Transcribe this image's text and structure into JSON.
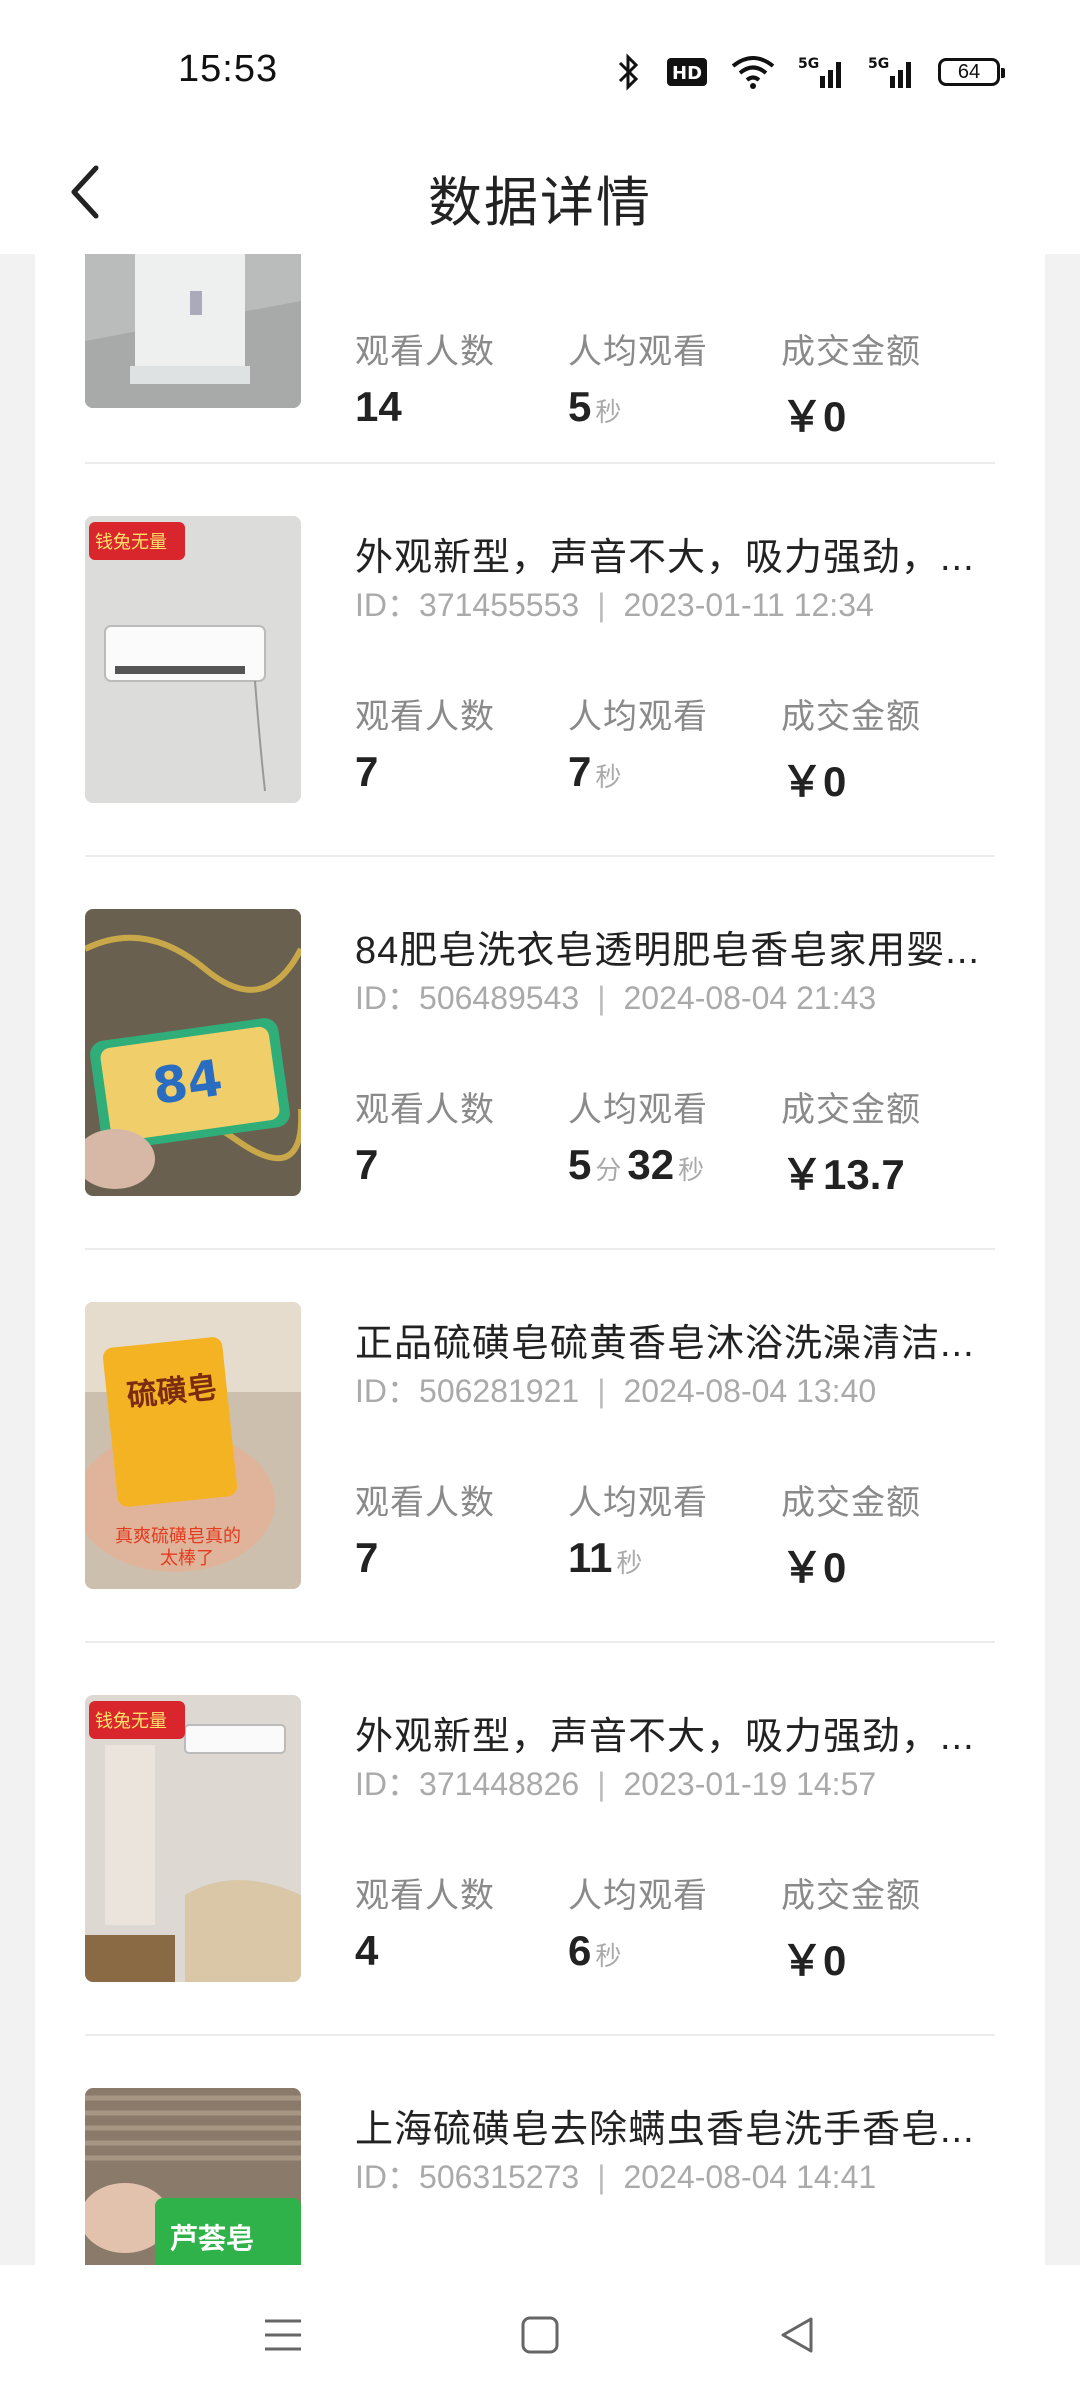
{
  "status_bar": {
    "time": "15:53",
    "icons": [
      "bluetooth-icon",
      "hd-icon",
      "wifi-icon",
      "signal-5g-icon",
      "signal-5g-icon"
    ],
    "battery": "64"
  },
  "header": {
    "title": "数据详情",
    "back_icon": "chevron-left-icon"
  },
  "labels": {
    "viewers": "观看人数",
    "avg_watch": "人均观看",
    "gmv": "成交金额",
    "id_prefix": "ID：",
    "sep": "|",
    "unit_sec": "秒",
    "unit_min": "分"
  },
  "items": [
    {
      "title": "",
      "id": "",
      "datetime": "",
      "viewers": "14",
      "avg_watch": {
        "min": "",
        "sec": "5"
      },
      "gmv": "￥0"
    },
    {
      "title": "外观新型，声音不大，吸力强劲，...",
      "id": "371455553",
      "datetime": "2023-01-11 12:34",
      "viewers": "7",
      "avg_watch": {
        "min": "",
        "sec": "7"
      },
      "gmv": "￥0",
      "badge": "钱兔无量"
    },
    {
      "title": "84肥皂洗衣皂透明肥皂香皂家用婴...",
      "id": "506489543",
      "datetime": "2024-08-04 21:43",
      "viewers": "7",
      "avg_watch": {
        "min": "5",
        "sec": "32"
      },
      "gmv": "￥13.7",
      "product_text": "84"
    },
    {
      "title": "正品硫磺皂硫黄香皂沐浴洗澡清洁...",
      "id": "506281921",
      "datetime": "2024-08-04 13:40",
      "viewers": "7",
      "avg_watch": {
        "min": "",
        "sec": "11"
      },
      "gmv": "￥0",
      "product_text": "硫磺皂",
      "caption": "真爽硫磺皂真的太棒了"
    },
    {
      "title": "外观新型，声音不大，吸力强劲，...",
      "id": "371448826",
      "datetime": "2023-01-19 14:57",
      "viewers": "4",
      "avg_watch": {
        "min": "",
        "sec": "6"
      },
      "gmv": "￥0",
      "badge": "钱兔无量"
    },
    {
      "title": "上海硫磺皂去除螨虫香皂洗手香皂...",
      "id": "506315273",
      "datetime": "2024-08-04 14:41",
      "viewers": "",
      "avg_watch": {
        "min": "",
        "sec": ""
      },
      "gmv": "",
      "product_text": "芦荟皂"
    }
  ],
  "nav": {
    "menu_icon": "menu-icon",
    "home_icon": "home-square-icon",
    "back_icon": "back-triangle-icon"
  }
}
